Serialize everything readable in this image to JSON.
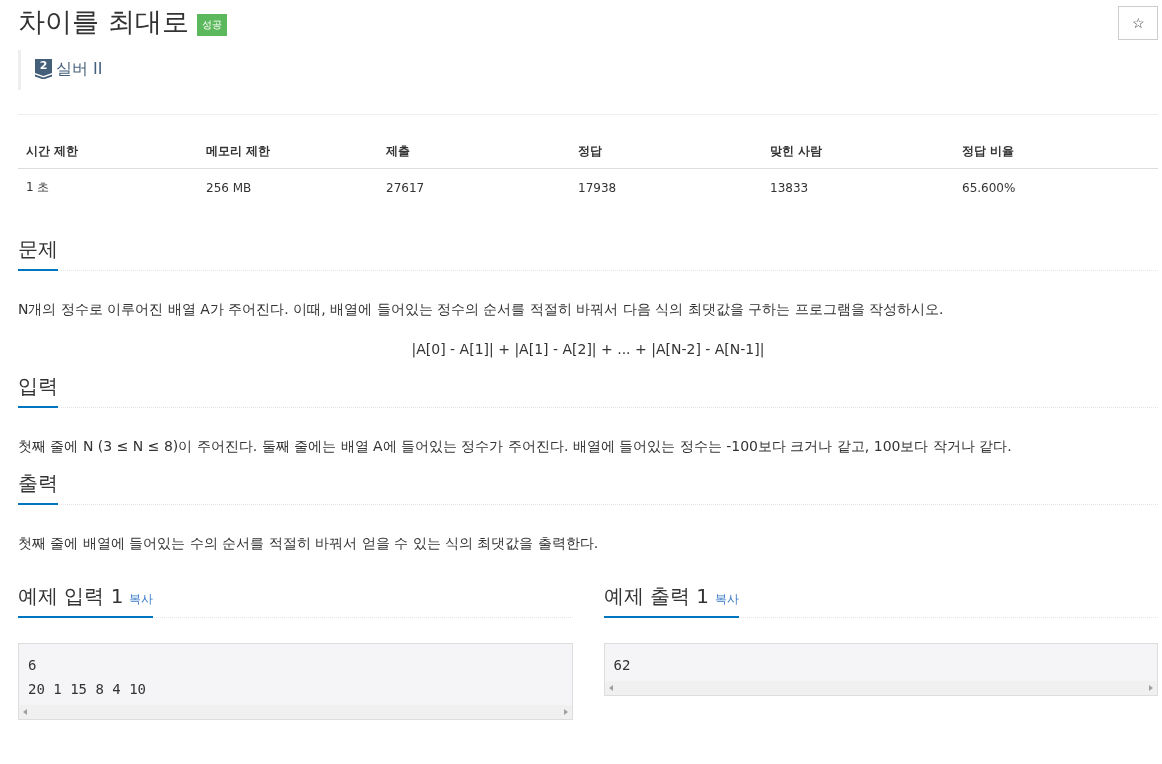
{
  "title": "차이를 최대로",
  "result_badge": "성공",
  "star_button": "☆",
  "tier": {
    "number": "2",
    "label": "실버 II"
  },
  "info_table": {
    "columns": [
      "시간 제한",
      "메모리 제한",
      "제출",
      "정답",
      "맞힌 사람",
      "정답 비율"
    ],
    "rows": [
      [
        "1 초",
        "256 MB",
        "27617",
        "17938",
        "13833",
        "65.600%"
      ]
    ]
  },
  "sections": [
    {
      "heading": "문제",
      "paragraphs": [
        {
          "kind": "text",
          "text": "N개의 정수로 이루어진 배열 A가 주어진다. 이때, 배열에 들어있는 정수의 순서를 적절히 바꿔서 다음 식의 최댓값을 구하는 프로그램을 작성하시오."
        },
        {
          "kind": "formula",
          "text": "|A[0] - A[1]| + |A[1] - A[2]| + ... + |A[N-2] - A[N-1]|"
        }
      ]
    },
    {
      "heading": "입력",
      "paragraphs": [
        {
          "kind": "text",
          "text": "첫째 줄에 N (3 ≤ N ≤ 8)이 주어진다. 둘째 줄에는 배열 A에 들어있는 정수가 주어진다. 배열에 들어있는 정수는 -100보다 크거나 같고, 100보다 작거나 같다."
        }
      ]
    },
    {
      "heading": "출력",
      "paragraphs": [
        {
          "kind": "text",
          "text": "첫째 줄에 배열에 들어있는 수의 순서를 적절히 바꿔서 얻을 수 있는 식의 최댓값을 출력한다."
        }
      ]
    }
  ],
  "examples": [
    {
      "heading": "예제 입력 1",
      "copy_link": "복사",
      "lines": [
        "6",
        "20 1 15 8 4 10"
      ]
    },
    {
      "heading": "예제 출력 1",
      "copy_link": "복사",
      "lines": [
        "62"
      ]
    }
  ]
}
